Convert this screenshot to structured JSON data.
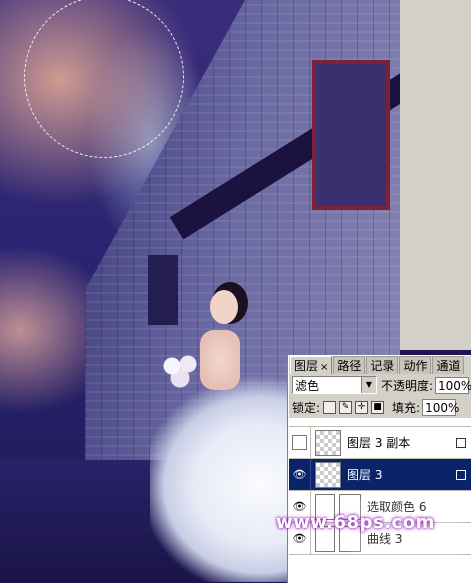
{
  "panel": {
    "tabs": [
      {
        "label": "图层",
        "active": true,
        "close": "×"
      },
      {
        "label": "路径",
        "active": false
      },
      {
        "label": "记录",
        "active": false
      },
      {
        "label": "动作",
        "active": false
      },
      {
        "label": "通道",
        "active": false
      }
    ],
    "blend_mode": "滤色",
    "opacity_label": "不透明度:",
    "opacity_value": "100%",
    "lock_label": "锁定:",
    "fill_label": "填充:",
    "fill_value": "100%",
    "layers": [
      {
        "name": "图层 3 副本",
        "visible": false,
        "locked": true,
        "selected": false
      },
      {
        "name": "图层 3",
        "visible": true,
        "locked": false,
        "selected": true
      },
      {
        "name": "选取颜色 6",
        "visible": true,
        "locked": false,
        "selected": false
      },
      {
        "name": "曲线 3",
        "visible": true,
        "locked": false,
        "selected": false
      }
    ]
  },
  "watermark": "www.68ps.com",
  "colors": {
    "selection_bg": "#0a246a",
    "panel_bg": "#d4d0c8",
    "watermark_glow": "#a020c0"
  }
}
